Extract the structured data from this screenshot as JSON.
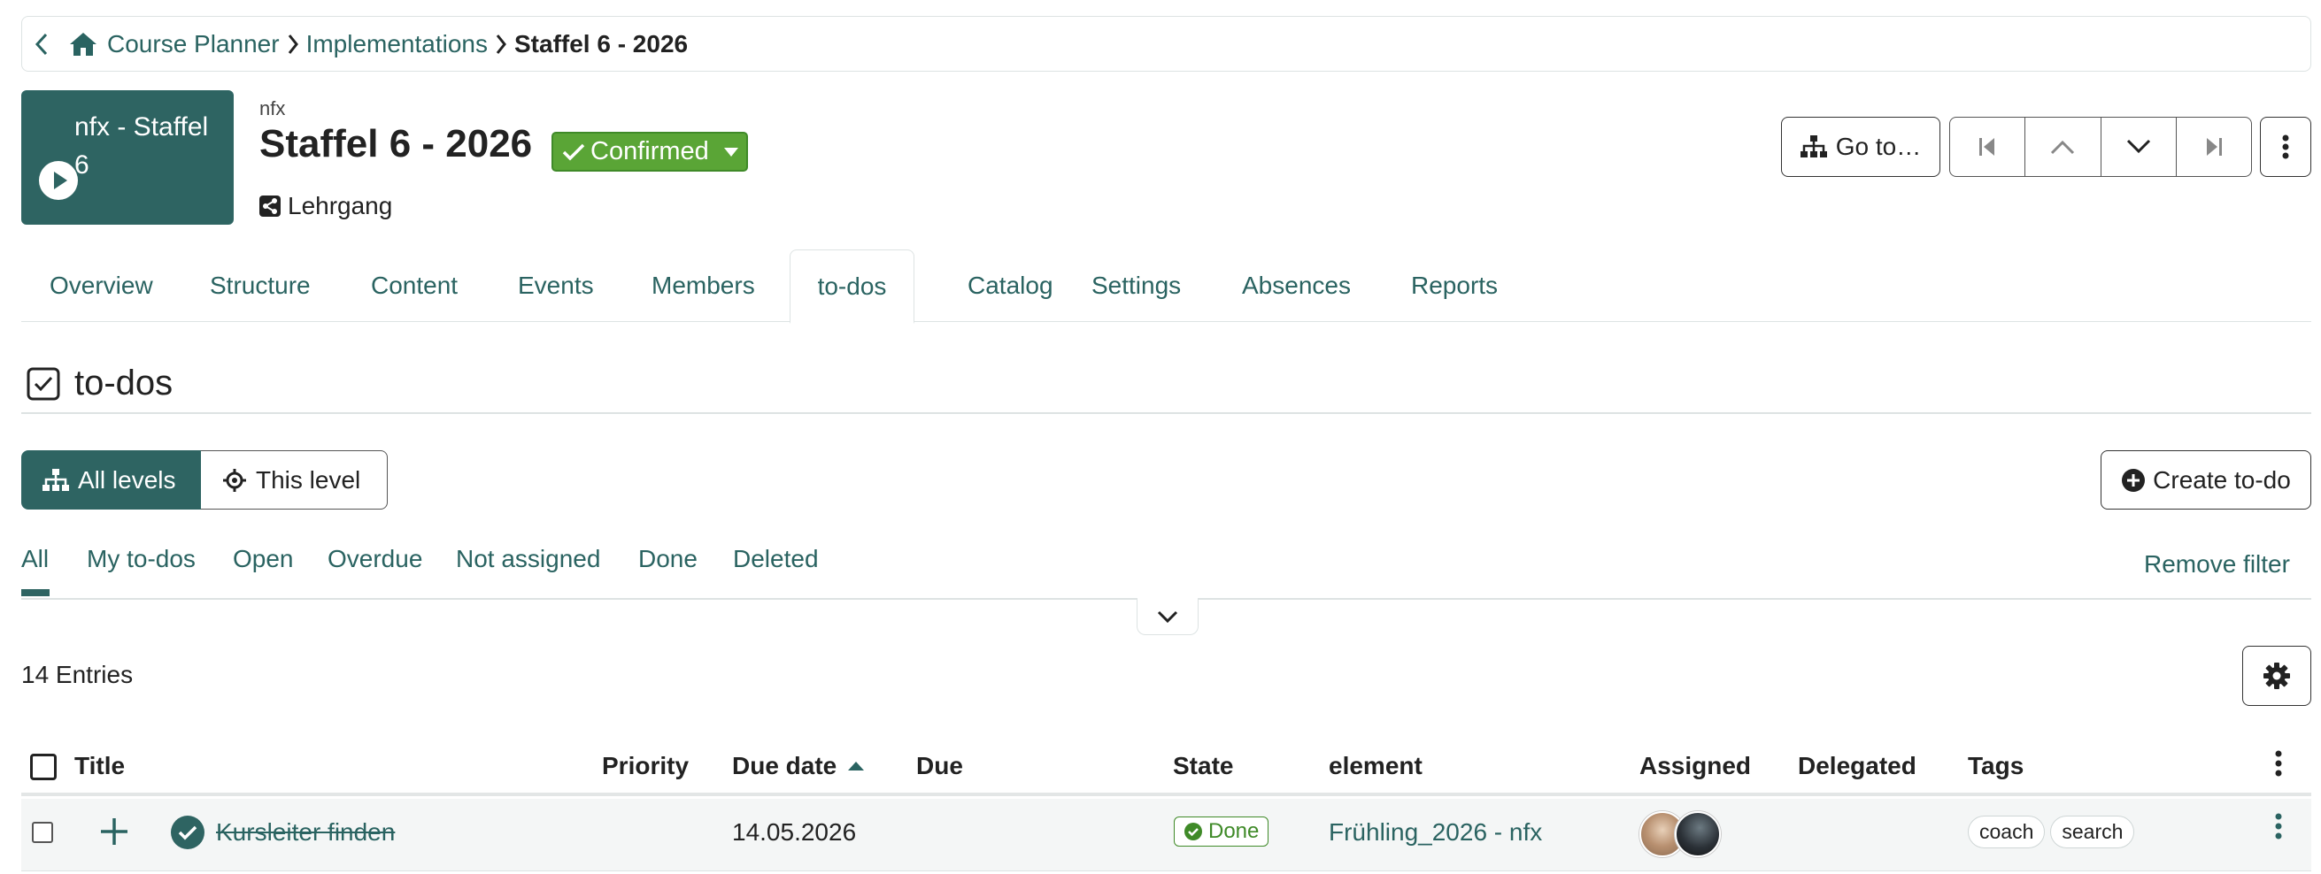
{
  "breadcrumb": {
    "home_label": "Course Planner",
    "level2": "Implementations",
    "current": "Staffel 6 - 2026"
  },
  "header": {
    "thumbnail_title": "nfx - Staffel 6",
    "small_label": "nfx",
    "title": "Staffel 6 - 2026",
    "status": "Confirmed",
    "type": "Lehrgang",
    "goto_label": "Go to…",
    "colors": {
      "accent": "#2e6462",
      "status": "#5aa536"
    }
  },
  "tabs": [
    "Overview",
    "Structure",
    "Content",
    "Events",
    "Members",
    "to-dos",
    "Catalog",
    "Settings",
    "Absences",
    "Reports"
  ],
  "active_tab": "to-dos",
  "section": {
    "title": "to-dos"
  },
  "levels": {
    "all": "All levels",
    "this": "This level"
  },
  "create_label": "Create to-do",
  "filters": [
    "All",
    "My to-dos",
    "Open",
    "Overdue",
    "Not assigned",
    "Done",
    "Deleted"
  ],
  "active_filter": "All",
  "remove_filter": "Remove filter",
  "entries": "14 Entries",
  "table": {
    "columns": [
      "Title",
      "Priority",
      "Due date",
      "Due",
      "State",
      "element",
      "Assigned",
      "Delegated",
      "Tags"
    ],
    "sort_column": "Due date",
    "rows": [
      {
        "title": "Kursleiter finden",
        "priority": "",
        "due_date": "14.05.2026",
        "due": "",
        "state": "Done",
        "element": "Frühling_2026 - nfx",
        "assigned": [
          "avatar-1",
          "avatar-2"
        ],
        "delegated": "",
        "tags": [
          "coach",
          "search"
        ]
      }
    ]
  }
}
